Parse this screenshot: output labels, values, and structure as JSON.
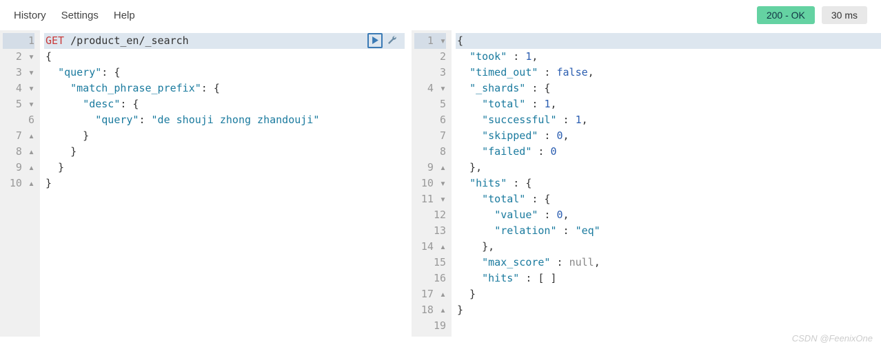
{
  "menu": {
    "history": "History",
    "settings": "Settings",
    "help": "Help"
  },
  "status": {
    "ok_label": "200 - OK",
    "time_label": "30 ms"
  },
  "request": {
    "gutter": [
      "1",
      "2 ▾",
      "3 ▾",
      "4 ▾",
      "5 ▾",
      "6",
      "7 ▴",
      "8 ▴",
      "9 ▴",
      "10 ▴"
    ],
    "method": "GET",
    "path": " /product_en/_search",
    "lines": [
      "{",
      "  \"query\": {",
      "    \"match_phrase_prefix\": {",
      "      \"desc\": {",
      "        \"query\": \"de shouji zhong zhandouji\"",
      "      }",
      "    }",
      "  }",
      "}"
    ]
  },
  "response": {
    "gutter": [
      "1 ▾",
      "2",
      "3",
      "4 ▾",
      "5",
      "6",
      "7",
      "8",
      "9 ▴",
      "10 ▾",
      "11 ▾",
      "12",
      "13",
      "14 ▴",
      "15",
      "16",
      "17 ▴",
      "18 ▴",
      "19"
    ],
    "lines_spec": [
      [
        [
          "p",
          "{"
        ]
      ],
      [
        [
          "p",
          "  "
        ],
        [
          "k",
          "\"took\""
        ],
        [
          "p",
          " : "
        ],
        [
          "n",
          "1"
        ],
        [
          "p",
          ","
        ]
      ],
      [
        [
          "p",
          "  "
        ],
        [
          "k",
          "\"timed_out\""
        ],
        [
          "p",
          " : "
        ],
        [
          "b",
          "false"
        ],
        [
          "p",
          ","
        ]
      ],
      [
        [
          "p",
          "  "
        ],
        [
          "k",
          "\"_shards\""
        ],
        [
          "p",
          " : {"
        ]
      ],
      [
        [
          "p",
          "    "
        ],
        [
          "k",
          "\"total\""
        ],
        [
          "p",
          " : "
        ],
        [
          "n",
          "1"
        ],
        [
          "p",
          ","
        ]
      ],
      [
        [
          "p",
          "    "
        ],
        [
          "k",
          "\"successful\""
        ],
        [
          "p",
          " : "
        ],
        [
          "n",
          "1"
        ],
        [
          "p",
          ","
        ]
      ],
      [
        [
          "p",
          "    "
        ],
        [
          "k",
          "\"skipped\""
        ],
        [
          "p",
          " : "
        ],
        [
          "n",
          "0"
        ],
        [
          "p",
          ","
        ]
      ],
      [
        [
          "p",
          "    "
        ],
        [
          "k",
          "\"failed\""
        ],
        [
          "p",
          " : "
        ],
        [
          "n",
          "0"
        ]
      ],
      [
        [
          "p",
          "  },"
        ]
      ],
      [
        [
          "p",
          "  "
        ],
        [
          "k",
          "\"hits\""
        ],
        [
          "p",
          " : {"
        ]
      ],
      [
        [
          "p",
          "    "
        ],
        [
          "k",
          "\"total\""
        ],
        [
          "p",
          " : {"
        ]
      ],
      [
        [
          "p",
          "      "
        ],
        [
          "k",
          "\"value\""
        ],
        [
          "p",
          " : "
        ],
        [
          "n",
          "0"
        ],
        [
          "p",
          ","
        ]
      ],
      [
        [
          "p",
          "      "
        ],
        [
          "k",
          "\"relation\""
        ],
        [
          "p",
          " : "
        ],
        [
          "s",
          "\"eq\""
        ]
      ],
      [
        [
          "p",
          "    },"
        ]
      ],
      [
        [
          "p",
          "    "
        ],
        [
          "k",
          "\"max_score\""
        ],
        [
          "p",
          " : "
        ],
        [
          "u",
          "null"
        ],
        [
          "p",
          ","
        ]
      ],
      [
        [
          "p",
          "    "
        ],
        [
          "k",
          "\"hits\""
        ],
        [
          "p",
          " : [ ]"
        ]
      ],
      [
        [
          "p",
          "  }"
        ]
      ],
      [
        [
          "p",
          "}"
        ]
      ],
      [
        [
          "p",
          ""
        ]
      ]
    ]
  },
  "watermark": "CSDN @FeenixOne"
}
